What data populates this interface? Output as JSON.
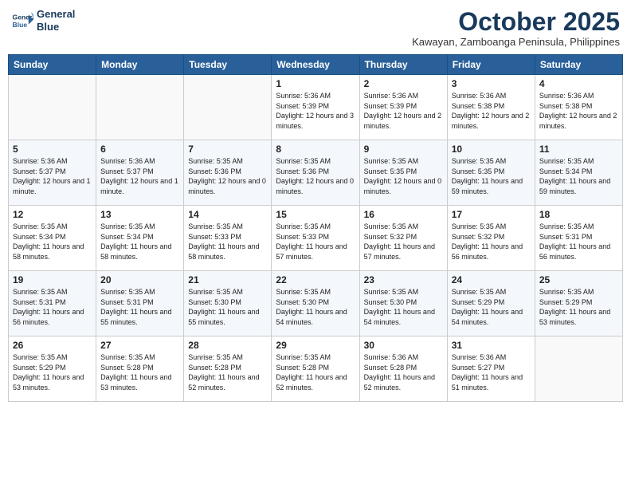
{
  "header": {
    "logo_line1": "General",
    "logo_line2": "Blue",
    "title": "October 2025",
    "subtitle": "Kawayan, Zamboanga Peninsula, Philippines"
  },
  "columns": [
    "Sunday",
    "Monday",
    "Tuesday",
    "Wednesday",
    "Thursday",
    "Friday",
    "Saturday"
  ],
  "weeks": [
    [
      {
        "day": "",
        "info": ""
      },
      {
        "day": "",
        "info": ""
      },
      {
        "day": "",
        "info": ""
      },
      {
        "day": "1",
        "info": "Sunrise: 5:36 AM\nSunset: 5:39 PM\nDaylight: 12 hours and 3 minutes."
      },
      {
        "day": "2",
        "info": "Sunrise: 5:36 AM\nSunset: 5:39 PM\nDaylight: 12 hours and 2 minutes."
      },
      {
        "day": "3",
        "info": "Sunrise: 5:36 AM\nSunset: 5:38 PM\nDaylight: 12 hours and 2 minutes."
      },
      {
        "day": "4",
        "info": "Sunrise: 5:36 AM\nSunset: 5:38 PM\nDaylight: 12 hours and 2 minutes."
      }
    ],
    [
      {
        "day": "5",
        "info": "Sunrise: 5:36 AM\nSunset: 5:37 PM\nDaylight: 12 hours and 1 minute."
      },
      {
        "day": "6",
        "info": "Sunrise: 5:36 AM\nSunset: 5:37 PM\nDaylight: 12 hours and 1 minute."
      },
      {
        "day": "7",
        "info": "Sunrise: 5:35 AM\nSunset: 5:36 PM\nDaylight: 12 hours and 0 minutes."
      },
      {
        "day": "8",
        "info": "Sunrise: 5:35 AM\nSunset: 5:36 PM\nDaylight: 12 hours and 0 minutes."
      },
      {
        "day": "9",
        "info": "Sunrise: 5:35 AM\nSunset: 5:35 PM\nDaylight: 12 hours and 0 minutes."
      },
      {
        "day": "10",
        "info": "Sunrise: 5:35 AM\nSunset: 5:35 PM\nDaylight: 11 hours and 59 minutes."
      },
      {
        "day": "11",
        "info": "Sunrise: 5:35 AM\nSunset: 5:34 PM\nDaylight: 11 hours and 59 minutes."
      }
    ],
    [
      {
        "day": "12",
        "info": "Sunrise: 5:35 AM\nSunset: 5:34 PM\nDaylight: 11 hours and 58 minutes."
      },
      {
        "day": "13",
        "info": "Sunrise: 5:35 AM\nSunset: 5:34 PM\nDaylight: 11 hours and 58 minutes."
      },
      {
        "day": "14",
        "info": "Sunrise: 5:35 AM\nSunset: 5:33 PM\nDaylight: 11 hours and 58 minutes."
      },
      {
        "day": "15",
        "info": "Sunrise: 5:35 AM\nSunset: 5:33 PM\nDaylight: 11 hours and 57 minutes."
      },
      {
        "day": "16",
        "info": "Sunrise: 5:35 AM\nSunset: 5:32 PM\nDaylight: 11 hours and 57 minutes."
      },
      {
        "day": "17",
        "info": "Sunrise: 5:35 AM\nSunset: 5:32 PM\nDaylight: 11 hours and 56 minutes."
      },
      {
        "day": "18",
        "info": "Sunrise: 5:35 AM\nSunset: 5:31 PM\nDaylight: 11 hours and 56 minutes."
      }
    ],
    [
      {
        "day": "19",
        "info": "Sunrise: 5:35 AM\nSunset: 5:31 PM\nDaylight: 11 hours and 56 minutes."
      },
      {
        "day": "20",
        "info": "Sunrise: 5:35 AM\nSunset: 5:31 PM\nDaylight: 11 hours and 55 minutes."
      },
      {
        "day": "21",
        "info": "Sunrise: 5:35 AM\nSunset: 5:30 PM\nDaylight: 11 hours and 55 minutes."
      },
      {
        "day": "22",
        "info": "Sunrise: 5:35 AM\nSunset: 5:30 PM\nDaylight: 11 hours and 54 minutes."
      },
      {
        "day": "23",
        "info": "Sunrise: 5:35 AM\nSunset: 5:30 PM\nDaylight: 11 hours and 54 minutes."
      },
      {
        "day": "24",
        "info": "Sunrise: 5:35 AM\nSunset: 5:29 PM\nDaylight: 11 hours and 54 minutes."
      },
      {
        "day": "25",
        "info": "Sunrise: 5:35 AM\nSunset: 5:29 PM\nDaylight: 11 hours and 53 minutes."
      }
    ],
    [
      {
        "day": "26",
        "info": "Sunrise: 5:35 AM\nSunset: 5:29 PM\nDaylight: 11 hours and 53 minutes."
      },
      {
        "day": "27",
        "info": "Sunrise: 5:35 AM\nSunset: 5:28 PM\nDaylight: 11 hours and 53 minutes."
      },
      {
        "day": "28",
        "info": "Sunrise: 5:35 AM\nSunset: 5:28 PM\nDaylight: 11 hours and 52 minutes."
      },
      {
        "day": "29",
        "info": "Sunrise: 5:35 AM\nSunset: 5:28 PM\nDaylight: 11 hours and 52 minutes."
      },
      {
        "day": "30",
        "info": "Sunrise: 5:36 AM\nSunset: 5:28 PM\nDaylight: 11 hours and 52 minutes."
      },
      {
        "day": "31",
        "info": "Sunrise: 5:36 AM\nSunset: 5:27 PM\nDaylight: 11 hours and 51 minutes."
      },
      {
        "day": "",
        "info": ""
      }
    ]
  ]
}
